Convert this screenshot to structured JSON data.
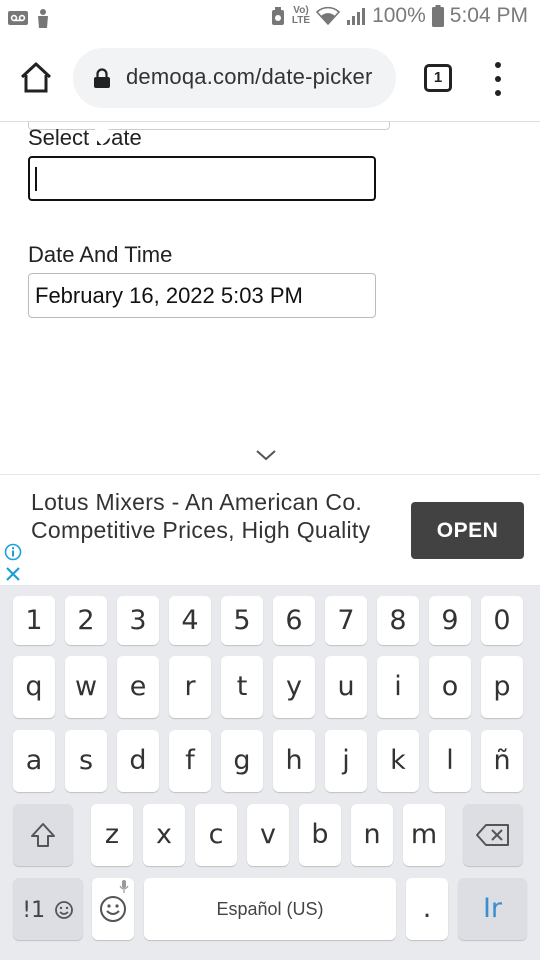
{
  "status_bar": {
    "lte_top": "Vo)",
    "lte_bottom": "LTE",
    "battery_percent": "100%",
    "time": "5:04 PM",
    "icons": [
      "voicemail-icon",
      "person-icon",
      "data-saver-icon",
      "wifi-icon",
      "signal-icon",
      "battery-icon"
    ]
  },
  "browser": {
    "url": "demoqa.com/date-picker",
    "tab_count": "1",
    "icons": [
      "home-icon",
      "lock-icon",
      "more-vert-icon"
    ]
  },
  "form": {
    "select_date_label": "Select Date",
    "select_date_value": "",
    "date_time_label": "Date And Time",
    "date_time_value": "February 16, 2022 5:03 PM"
  },
  "ad": {
    "text": "Lotus Mixers - An American Co. Competitive Prices, High Quality",
    "button_label": "OPEN",
    "icons": [
      "info-icon",
      "close-icon"
    ]
  },
  "keyboard": {
    "number_row": [
      "1",
      "2",
      "3",
      "4",
      "5",
      "6",
      "7",
      "8",
      "9",
      "0"
    ],
    "row1": [
      "q",
      "w",
      "e",
      "r",
      "t",
      "y",
      "u",
      "i",
      "o",
      "p"
    ],
    "row2": [
      "a",
      "s",
      "d",
      "f",
      "g",
      "h",
      "j",
      "k",
      "l",
      "ñ"
    ],
    "row3": [
      "z",
      "x",
      "c",
      "v",
      "b",
      "n",
      "m"
    ],
    "symbols_label": "!1",
    "space_label": "Español (US)",
    "period_label": ".",
    "go_label": "Ir",
    "accent_color": "#3a8ed0"
  }
}
